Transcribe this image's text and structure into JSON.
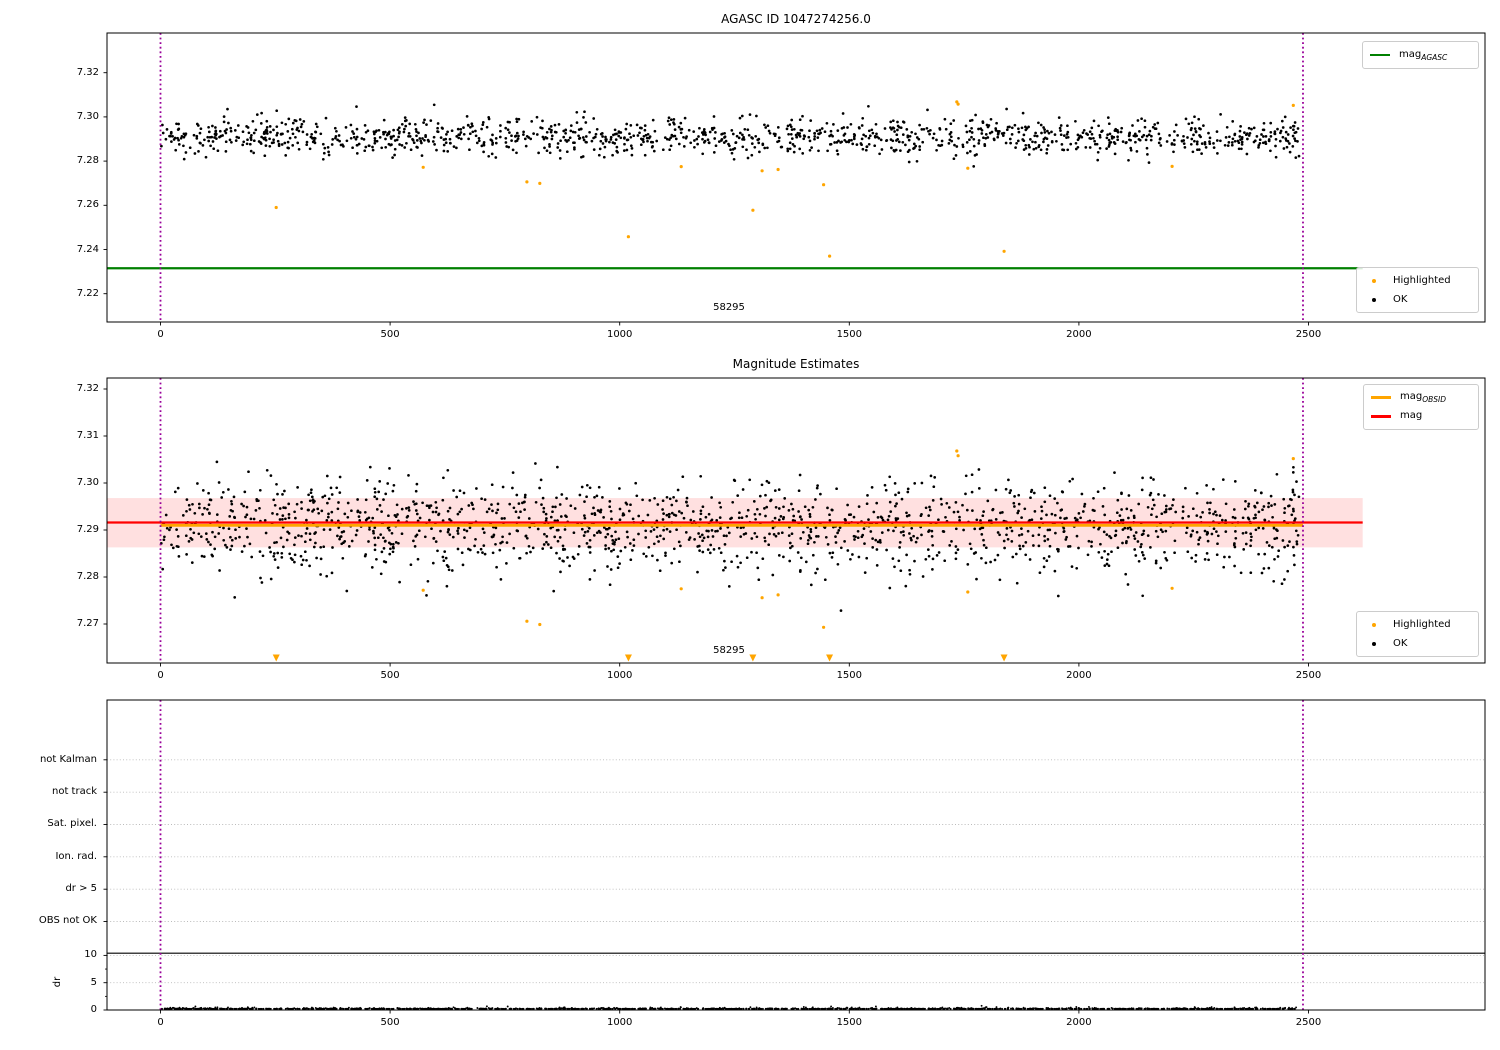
{
  "chart_data": [
    {
      "type": "scatter",
      "panel": "agasc-mag",
      "title": "AGASC ID 1047274256.0",
      "xlim": [
        -116,
        2885
      ],
      "ylim": [
        7.207,
        7.338
      ],
      "x_ticks": [
        {
          "v": 0,
          "label": "0"
        },
        {
          "v": 500,
          "label": "500"
        },
        {
          "v": 1000,
          "label": "1000"
        },
        {
          "v": 1500,
          "label": "1500"
        },
        {
          "v": 2000,
          "label": "2000"
        },
        {
          "v": 2500,
          "label": "2500"
        }
      ],
      "y_ticks": [
        {
          "v": 7.22,
          "label": "7.22"
        },
        {
          "v": 7.24,
          "label": "7.24"
        },
        {
          "v": 7.26,
          "label": "7.26"
        },
        {
          "v": 7.28,
          "label": "7.28"
        },
        {
          "v": 7.3,
          "label": "7.30"
        },
        {
          "v": 7.32,
          "label": "7.32"
        }
      ],
      "agasc_mag_line": {
        "value": 7.2315,
        "color": "#008000",
        "x_start": -116,
        "x_end": 2618
      },
      "obs_window_lines": {
        "x": [
          0,
          2488
        ],
        "color": "#990099",
        "style": "dotted"
      },
      "ok_points": {
        "count": 1300,
        "x_min": 0,
        "x_max": 2480,
        "mag_mean": 7.2912,
        "mag_std": 0.0042,
        "mag_min": 7.2775,
        "mag_max": 7.3055,
        "color": "#000000"
      },
      "highlighted_points": {
        "color": "#FFA500",
        "xy": [
          [
            252,
            7.259
          ],
          [
            572,
            7.2772
          ],
          [
            798,
            7.2706
          ],
          [
            826,
            7.2699
          ],
          [
            1019,
            7.2458
          ],
          [
            1134,
            7.2775
          ],
          [
            1290,
            7.2578
          ],
          [
            1310,
            7.2756
          ],
          [
            1345,
            7.2762
          ],
          [
            1444,
            7.2693
          ],
          [
            1457,
            7.237
          ],
          [
            1734,
            7.3068
          ],
          [
            1737,
            7.3058
          ],
          [
            1758,
            7.2768
          ],
          [
            1837,
            7.2392
          ],
          [
            2203,
            7.2776
          ],
          [
            2467,
            7.3052
          ]
        ]
      },
      "annotation": {
        "text": "58295",
        "x": 1238
      },
      "legends": [
        {
          "items": [
            {
              "type": "line",
              "color": "#008000",
              "main": "mag",
              "sub": "AGASC"
            }
          ]
        },
        {
          "items": [
            {
              "type": "dot",
              "color": "#FFA500",
              "label": "Highlighted"
            },
            {
              "type": "dot",
              "color": "#000000",
              "label": "OK"
            }
          ]
        }
      ]
    },
    {
      "type": "scatter",
      "panel": "magnitude-estimates",
      "title": "Magnitude Estimates",
      "xlim": [
        -116,
        2885
      ],
      "ylim": [
        7.2617,
        7.3226
      ],
      "x_ticks": [
        {
          "v": 0,
          "label": "0"
        },
        {
          "v": 500,
          "label": "500"
        },
        {
          "v": 1000,
          "label": "1000"
        },
        {
          "v": 1500,
          "label": "1500"
        },
        {
          "v": 2000,
          "label": "2000"
        },
        {
          "v": 2500,
          "label": "2500"
        }
      ],
      "y_ticks": [
        {
          "v": 7.27,
          "label": "7.27"
        },
        {
          "v": 7.28,
          "label": "7.28"
        },
        {
          "v": 7.29,
          "label": "7.29"
        },
        {
          "v": 7.3,
          "label": "7.30"
        },
        {
          "v": 7.31,
          "label": "7.31"
        },
        {
          "v": 7.32,
          "label": "7.32"
        }
      ],
      "mag_line": {
        "value": 7.2916,
        "color": "#FF0000",
        "x_start": -116,
        "x_end": 2618
      },
      "mag_obsid_line": {
        "value": 7.291,
        "color": "#FFA500",
        "x_start": 0,
        "x_end": 2488
      },
      "uncertainty_band": {
        "low": 7.2863,
        "high": 7.2968,
        "color": "rgba(255,0,0,0.12)",
        "x_start": -116,
        "x_end": 2618
      },
      "obs_window_lines": {
        "x": [
          0,
          2488
        ],
        "color": "#990099",
        "style": "dotted"
      },
      "ok_points": {
        "count": 1600,
        "x_min": 0,
        "x_max": 2480,
        "mag_mean": 7.2908,
        "mag_std": 0.005,
        "mag_min": 7.2655,
        "mag_max": 7.3045,
        "color": "#000000"
      },
      "highlighted_points": {
        "color": "#FFA500",
        "xy": [
          [
            252,
            7.259
          ],
          [
            572,
            7.2772
          ],
          [
            798,
            7.2706
          ],
          [
            826,
            7.2699
          ],
          [
            1019,
            7.2458
          ],
          [
            1134,
            7.2775
          ],
          [
            1290,
            7.2578
          ],
          [
            1310,
            7.2756
          ],
          [
            1345,
            7.2762
          ],
          [
            1444,
            7.2693
          ],
          [
            1457,
            7.237
          ],
          [
            1734,
            7.3068
          ],
          [
            1737,
            7.3058
          ],
          [
            1758,
            7.2768
          ],
          [
            1837,
            7.2392
          ],
          [
            2203,
            7.2776
          ],
          [
            2467,
            7.3052
          ]
        ]
      },
      "clip_marker": "triangle-down",
      "annotation": {
        "text": "58295",
        "x": 1238
      },
      "legends": [
        {
          "items": [
            {
              "type": "line",
              "color": "#FFA500",
              "main": "mag",
              "sub": "OBSID"
            },
            {
              "type": "line",
              "color": "#FF0000",
              "main": "mag",
              "sub": ""
            }
          ]
        },
        {
          "items": [
            {
              "type": "dot",
              "color": "#FFA500",
              "label": "Highlighted"
            },
            {
              "type": "dot",
              "color": "#000000",
              "label": "OK"
            }
          ]
        }
      ]
    },
    {
      "type": "flags-and-dr",
      "panel": "flags-dr",
      "title": "",
      "flag_labels": [
        "not Kalman",
        "not track",
        "Sat. pixel.",
        "Ion. rad.",
        "dr > 5",
        "OBS not OK"
      ],
      "flag_points": [],
      "ylabel": "dr",
      "dr_ticks": [
        {
          "v": 0,
          "label": "0"
        },
        {
          "v": 5,
          "label": "5"
        },
        {
          "v": 10,
          "label": "10"
        }
      ],
      "x_ticks": [
        {
          "v": 0,
          "label": "0"
        },
        {
          "v": 500,
          "label": "500"
        },
        {
          "v": 1000,
          "label": "1000"
        },
        {
          "v": 1500,
          "label": "1500"
        },
        {
          "v": 2000,
          "label": "2000"
        },
        {
          "v": 2500,
          "label": "2500"
        }
      ],
      "threshold_line": {
        "value": 10.4,
        "color": "#000000"
      },
      "dr_points": {
        "count": 1600,
        "x_min": 0,
        "x_max": 2480,
        "dr_typical": 0.2,
        "dr_max": 1.15,
        "color": "#000000"
      },
      "obs_window_lines": {
        "x": [
          0,
          2488
        ],
        "color": "#990099",
        "style": "dotted"
      },
      "grid": true
    }
  ]
}
